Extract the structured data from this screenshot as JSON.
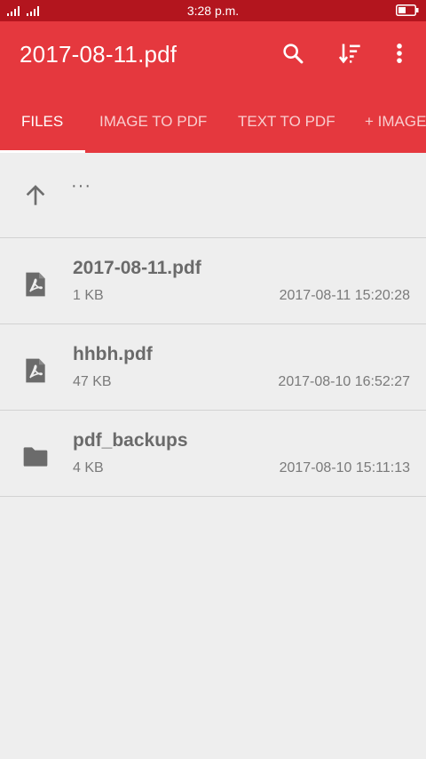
{
  "status_bar": {
    "time": "3:28 p.m."
  },
  "app_bar": {
    "title": "2017-08-11.pdf",
    "colors": {
      "status_bar": "#b3151e",
      "toolbar": "#e5383e"
    },
    "actions": [
      "search-icon",
      "sort-icon",
      "more-vert-icon"
    ]
  },
  "tabs": [
    {
      "label": "FILES",
      "active": true
    },
    {
      "label": "IMAGE TO PDF",
      "active": false
    },
    {
      "label": "TEXT TO PDF",
      "active": false
    },
    {
      "label": "+ IMAGE",
      "active": false
    }
  ],
  "file_list": {
    "parent_label": "···",
    "items": [
      {
        "name": "2017-08-11.pdf",
        "size": "1 KB",
        "date": "2017-08-11 15:20:28",
        "icon": "pdf-file-icon"
      },
      {
        "name": "hhbh.pdf",
        "size": "47 KB",
        "date": "2017-08-10 16:52:27",
        "icon": "pdf-file-icon"
      },
      {
        "name": "pdf_backups",
        "size": "4 KB",
        "date": "2017-08-10 15:11:13",
        "icon": "folder-icon"
      }
    ]
  }
}
